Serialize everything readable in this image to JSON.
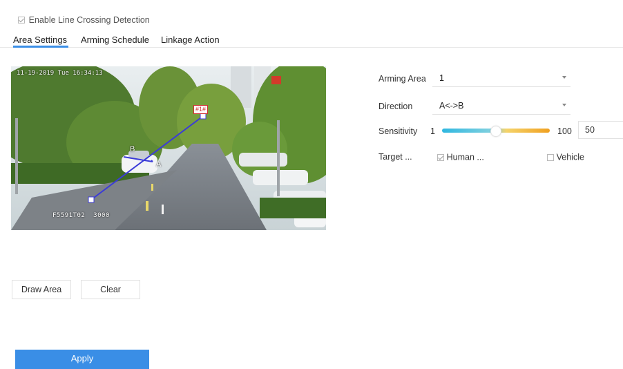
{
  "enable": {
    "label": "Enable Line Crossing Detection",
    "checked": true
  },
  "tabs": [
    {
      "label": "Area Settings",
      "active": true
    },
    {
      "label": "Arming Schedule",
      "active": false
    },
    {
      "label": "Linkage Action",
      "active": false
    }
  ],
  "video": {
    "timestamp": "11-19-2019 Tue 16:34:13",
    "channel_label": "F5591T02  3000",
    "line_id": "#1#",
    "point_a": "A",
    "point_b": "B"
  },
  "settings": {
    "arming_area": {
      "label": "Arming Area",
      "value": "1"
    },
    "direction": {
      "label": "Direction",
      "value": "A<->B"
    },
    "sensitivity": {
      "label": "Sensitivity",
      "min": "1",
      "max": "100",
      "value": "50"
    },
    "target": {
      "label": "Target ...",
      "options": [
        {
          "label": "Human ...",
          "checked": true
        },
        {
          "label": "Vehicle",
          "checked": false
        }
      ]
    }
  },
  "buttons": {
    "draw_area": "Draw Area",
    "clear": "Clear",
    "apply": "Apply"
  },
  "colors": {
    "accent": "#3a8ee6",
    "slider_start": "#2fb7e0",
    "slider_end": "#f0a020",
    "line": "#3b3bd8"
  }
}
